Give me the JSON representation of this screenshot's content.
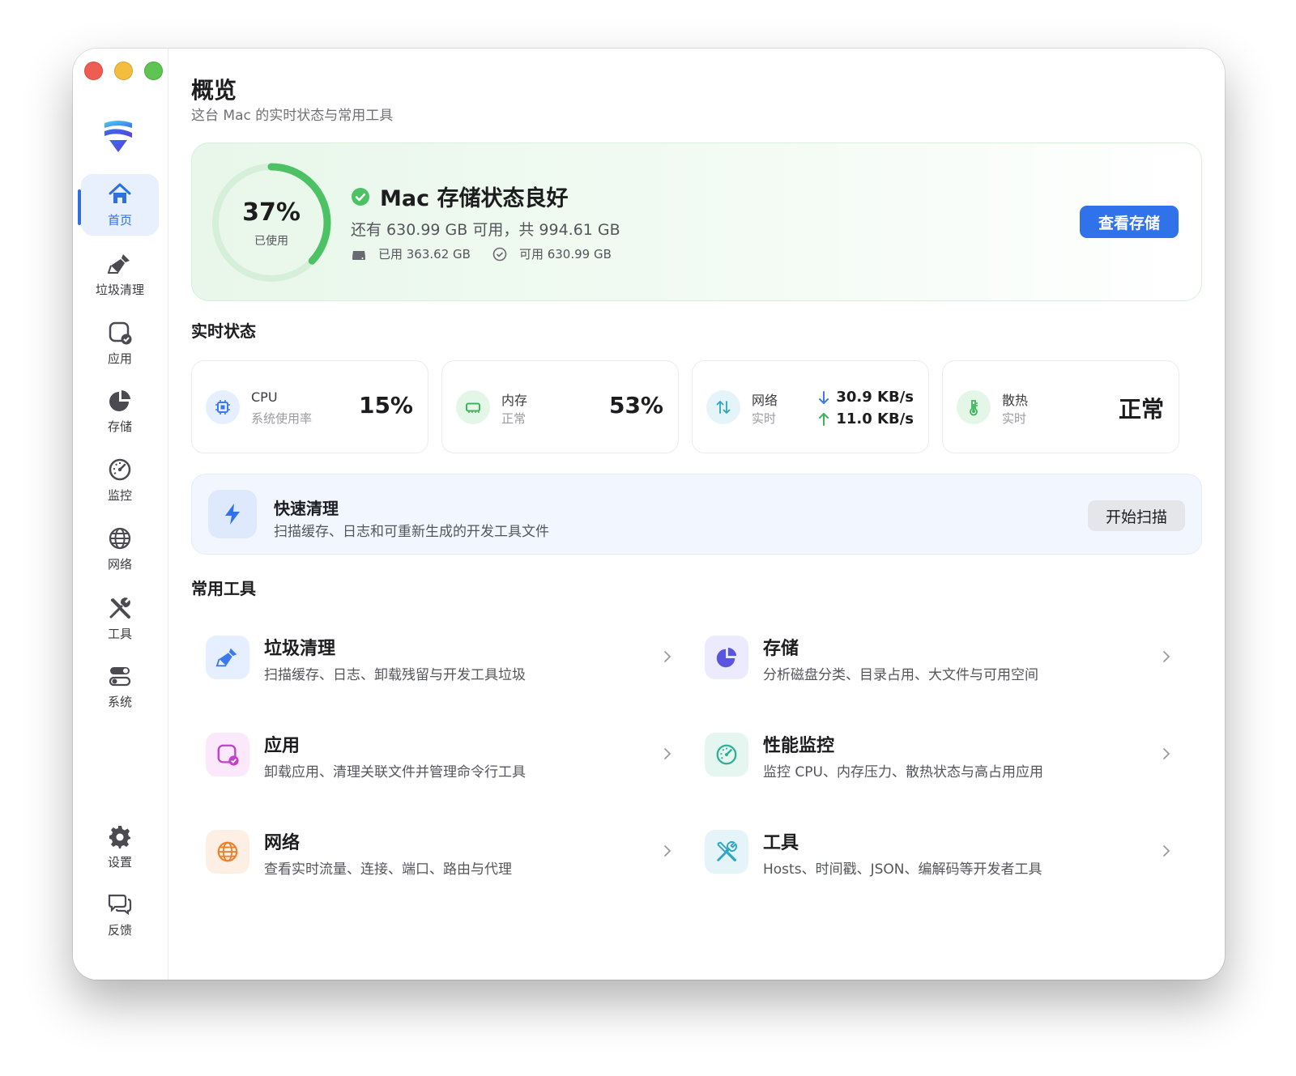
{
  "colors": {
    "accent": "#2f72ea",
    "status_good": "#4cc265",
    "sidebar_active_bg": "#e8f0fd"
  },
  "sidebar": {
    "items": [
      {
        "label": "首页",
        "icon": "home-icon",
        "active": true
      },
      {
        "label": "垃圾清理",
        "icon": "broom-icon"
      },
      {
        "label": "应用",
        "icon": "app-check-icon"
      },
      {
        "label": "存储",
        "icon": "pie-chart-icon"
      },
      {
        "label": "监控",
        "icon": "gauge-icon"
      },
      {
        "label": "网络",
        "icon": "globe-icon"
      },
      {
        "label": "工具",
        "icon": "tools-icon"
      },
      {
        "label": "系统",
        "icon": "toggles-icon"
      }
    ],
    "bottom_items": [
      {
        "label": "设置",
        "icon": "gear-icon"
      },
      {
        "label": "反馈",
        "icon": "chat-bubbles-icon"
      }
    ]
  },
  "header": {
    "title": "概览",
    "subtitle": "这台 Mac 的实时状态与常用工具"
  },
  "storage": {
    "used_percent": 37,
    "percent_text": "37%",
    "ring_label": "已使用",
    "status_title": "Mac 存储状态良好",
    "summary": "还有 630.99 GB 可用，共 994.61 GB",
    "used_text": "已用 363.62 GB",
    "free_text": "可用 630.99 GB",
    "button_label": "查看存储"
  },
  "realtime": {
    "section_title": "实时状态",
    "cpu": {
      "name": "CPU",
      "desc": "系统使用率",
      "value": "15%"
    },
    "memory": {
      "name": "内存",
      "desc": "正常",
      "value": "53%"
    },
    "network": {
      "name": "网络",
      "desc": "实时",
      "down": "30.9 KB/s",
      "up": "11.0 KB/s"
    },
    "thermal": {
      "name": "散热",
      "desc": "实时",
      "value": "正常"
    }
  },
  "quick_clean": {
    "title": "快速清理",
    "subtitle": "扫描缓存、日志和可重新生成的开发工具文件",
    "button_label": "开始扫描"
  },
  "tools": {
    "section_title": "常用工具",
    "items": [
      {
        "title": "垃圾清理",
        "subtitle": "扫描缓存、日志、卸载残留与开发工具垃圾",
        "icon": "broom-icon"
      },
      {
        "title": "存储",
        "subtitle": "分析磁盘分类、目录占用、大文件与可用空间",
        "icon": "pie-chart-icon"
      },
      {
        "title": "应用",
        "subtitle": "卸载应用、清理关联文件并管理命令行工具",
        "icon": "app-check-icon"
      },
      {
        "title": "性能监控",
        "subtitle": "监控 CPU、内存压力、散热状态与高占用应用",
        "icon": "gauge-icon"
      },
      {
        "title": "网络",
        "subtitle": "查看实时流量、连接、端口、路由与代理",
        "icon": "globe-icon"
      },
      {
        "title": "工具",
        "subtitle": "Hosts、时间戳、JSON、编解码等开发者工具",
        "icon": "tools-icon"
      }
    ]
  }
}
